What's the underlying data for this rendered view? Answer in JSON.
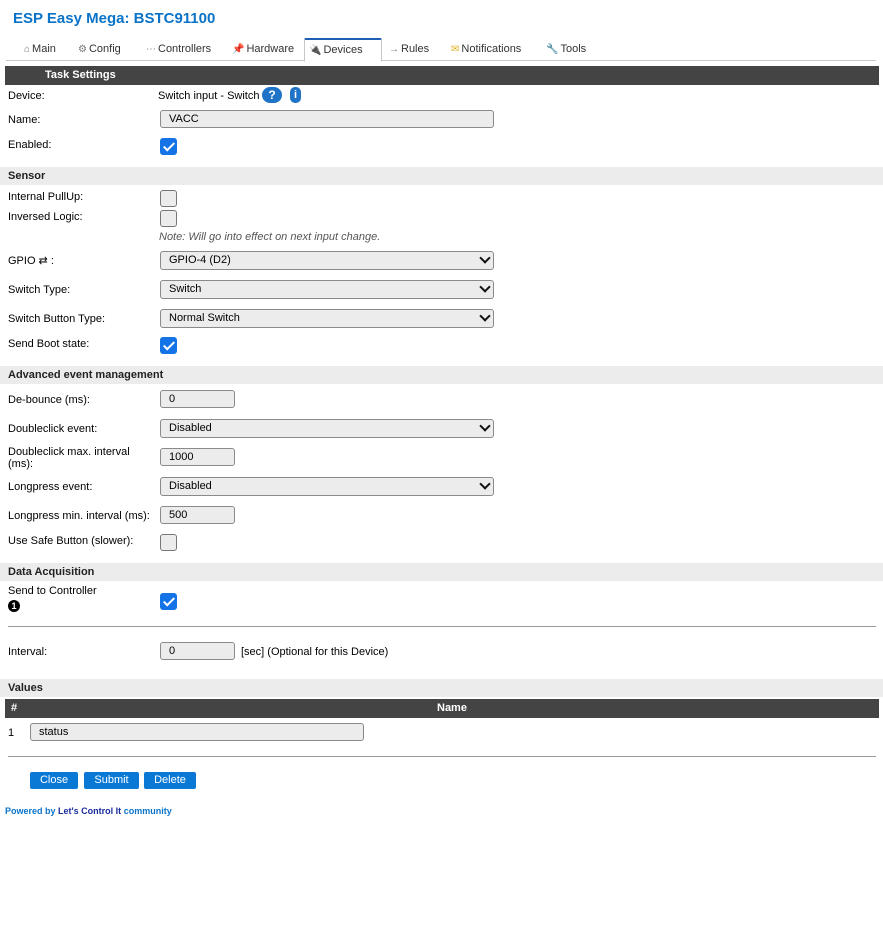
{
  "header": {
    "title": "ESP Easy Mega: BSTC91100"
  },
  "tabs": [
    {
      "label": "Main",
      "icon": "⌂"
    },
    {
      "label": "Config",
      "icon": "⚙"
    },
    {
      "label": "Controllers",
      "icon": "⋯"
    },
    {
      "label": "Hardware",
      "icon": "📌"
    },
    {
      "label": "Devices",
      "icon": "🔌"
    },
    {
      "label": "Rules",
      "icon": "→"
    },
    {
      "label": "Notifications",
      "icon": "✉"
    },
    {
      "label": "Tools",
      "icon": "🔧"
    }
  ],
  "task": {
    "header": "Task Settings",
    "device_label": "Device:",
    "device_value": "Switch input - Switch",
    "help_glyph": "?",
    "info_glyph": "i",
    "name_label": "Name:",
    "name_value": "VACC",
    "enabled_label": "Enabled:",
    "enabled": true
  },
  "sensor": {
    "header": "Sensor",
    "pullup_label": "Internal PullUp:",
    "pullup": false,
    "inversed_label": "Inversed Logic:",
    "inversed": false,
    "note": "Note: Will go into effect on next input change.",
    "gpio_label": "GPIO ⇄ :",
    "gpio_value": "GPIO-4 (D2)",
    "switch_type_label": "Switch Type:",
    "switch_type_value": "Switch",
    "switch_button_label": "Switch Button Type:",
    "switch_button_value": "Normal Switch",
    "boot_label": "Send Boot state:",
    "boot": true
  },
  "advanced": {
    "header": "Advanced event management",
    "debounce_label": "De-bounce (ms):",
    "debounce_value": "0",
    "dblclick_label": "Doubleclick event:",
    "dblclick_value": "Disabled",
    "dblclick_interval_label_1": "Doubleclick max. interval",
    "dblclick_interval_label_2": "(ms):",
    "dblclick_interval_value": "1000",
    "longpress_label": "Longpress event:",
    "longpress_value": "Disabled",
    "longpress_interval_label": "Longpress min. interval (ms):",
    "longpress_interval_value": "500",
    "safe_label": "Use Safe Button (slower):",
    "safe": false
  },
  "acquisition": {
    "header": "Data Acquisition",
    "send_label": "Send to Controller",
    "controller_number": "1",
    "send": true,
    "interval_label": "Interval:",
    "interval_value": "0",
    "interval_unit": "[sec] (Optional for this Device)"
  },
  "values": {
    "header": "Values",
    "col_number": "#",
    "col_name": "Name",
    "rows": [
      {
        "index": "1",
        "name": "status"
      }
    ]
  },
  "actions": {
    "close": "Close",
    "submit": "Submit",
    "delete": "Delete"
  },
  "footer": {
    "prefix": "Powered by",
    "link": "Let's Control It",
    "suffix": "community"
  },
  "colors": {
    "accent": "#0b73c8",
    "button": "#0a79d6",
    "header_bg": "#444444",
    "checkbox": "#1473e6"
  }
}
